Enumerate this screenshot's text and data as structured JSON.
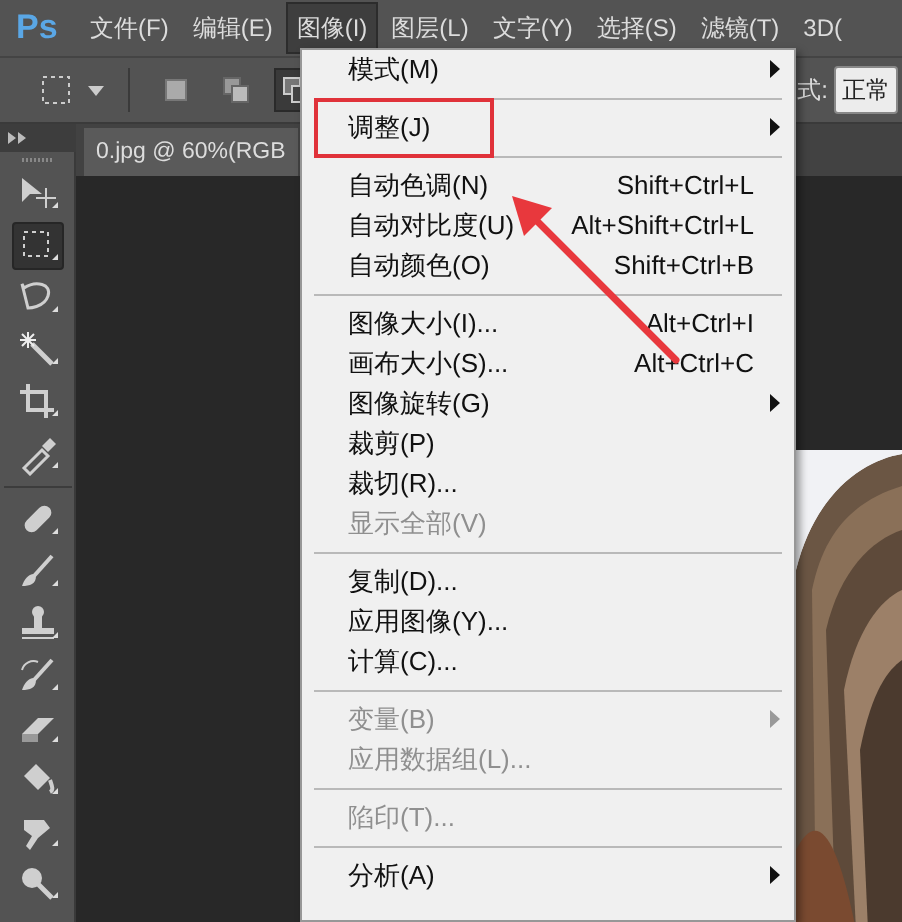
{
  "app_logo": "Ps",
  "menubar": [
    {
      "label": "文件(F)",
      "selected": false
    },
    {
      "label": "编辑(E)",
      "selected": false
    },
    {
      "label": "图像(I)",
      "selected": true
    },
    {
      "label": "图层(L)",
      "selected": false
    },
    {
      "label": "文字(Y)",
      "selected": false
    },
    {
      "label": "选择(S)",
      "selected": false
    },
    {
      "label": "滤镜(T)",
      "selected": false
    },
    {
      "label": "3D(",
      "selected": false
    }
  ],
  "options_bar": {
    "modes": [
      {
        "selected": false
      },
      {
        "selected": false
      },
      {
        "selected": true
      }
    ],
    "style_label": "式:",
    "style_value": "正常"
  },
  "document_tab": "0.jpg @ 60%(RGB",
  "tools": [
    {
      "kind": "move",
      "selected": false
    },
    {
      "kind": "marquee",
      "selected": true
    },
    {
      "kind": "lasso",
      "selected": false
    },
    {
      "kind": "wand",
      "selected": false
    },
    {
      "kind": "crop",
      "selected": false
    },
    {
      "kind": "eyedropper",
      "selected": false
    },
    {
      "kind": "heal",
      "selected": false
    },
    {
      "kind": "brush",
      "selected": false
    },
    {
      "kind": "stamp",
      "selected": false
    },
    {
      "kind": "history",
      "selected": false
    },
    {
      "kind": "eraser",
      "selected": false
    },
    {
      "kind": "bucket",
      "selected": false
    },
    {
      "kind": "smudge",
      "selected": false
    },
    {
      "kind": "dodge",
      "selected": false
    }
  ],
  "dropdown": [
    {
      "kind": "item",
      "label": "模式(M)",
      "submenu": true,
      "disabled": false,
      "highlighted": false
    },
    {
      "kind": "separator"
    },
    {
      "kind": "item",
      "label": "调整(J)",
      "submenu": true,
      "disabled": false,
      "highlighted": true
    },
    {
      "kind": "separator"
    },
    {
      "kind": "item",
      "label": "自动色调(N)",
      "shortcut": "Shift+Ctrl+L",
      "submenu": false,
      "disabled": false,
      "highlighted": false
    },
    {
      "kind": "item",
      "label": "自动对比度(U)",
      "shortcut": "Alt+Shift+Ctrl+L",
      "submenu": false,
      "disabled": false,
      "highlighted": false
    },
    {
      "kind": "item",
      "label": "自动颜色(O)",
      "shortcut": "Shift+Ctrl+B",
      "submenu": false,
      "disabled": false,
      "highlighted": false
    },
    {
      "kind": "separator"
    },
    {
      "kind": "item",
      "label": "图像大小(I)...",
      "shortcut": "Alt+Ctrl+I",
      "submenu": false,
      "disabled": false,
      "highlighted": false
    },
    {
      "kind": "item",
      "label": "画布大小(S)...",
      "shortcut": "Alt+Ctrl+C",
      "submenu": false,
      "disabled": false,
      "highlighted": false
    },
    {
      "kind": "item",
      "label": "图像旋转(G)",
      "submenu": true,
      "disabled": false,
      "highlighted": false
    },
    {
      "kind": "item",
      "label": "裁剪(P)",
      "submenu": false,
      "disabled": false,
      "highlighted": false
    },
    {
      "kind": "item",
      "label": "裁切(R)...",
      "submenu": false,
      "disabled": false,
      "highlighted": false
    },
    {
      "kind": "item",
      "label": "显示全部(V)",
      "submenu": false,
      "disabled": true,
      "highlighted": false
    },
    {
      "kind": "separator"
    },
    {
      "kind": "item",
      "label": "复制(D)...",
      "submenu": false,
      "disabled": false,
      "highlighted": false
    },
    {
      "kind": "item",
      "label": "应用图像(Y)...",
      "submenu": false,
      "disabled": false,
      "highlighted": false
    },
    {
      "kind": "item",
      "label": "计算(C)...",
      "submenu": false,
      "disabled": false,
      "highlighted": false
    },
    {
      "kind": "separator"
    },
    {
      "kind": "item",
      "label": "变量(B)",
      "submenu": true,
      "disabled": true,
      "highlighted": false
    },
    {
      "kind": "item",
      "label": "应用数据组(L)...",
      "submenu": false,
      "disabled": true,
      "highlighted": false
    },
    {
      "kind": "separator"
    },
    {
      "kind": "item",
      "label": "陷印(T)...",
      "submenu": false,
      "disabled": true,
      "highlighted": false
    },
    {
      "kind": "separator"
    },
    {
      "kind": "item",
      "label": "分析(A)",
      "submenu": true,
      "disabled": false,
      "highlighted": false
    }
  ],
  "annotation_arrow": true
}
